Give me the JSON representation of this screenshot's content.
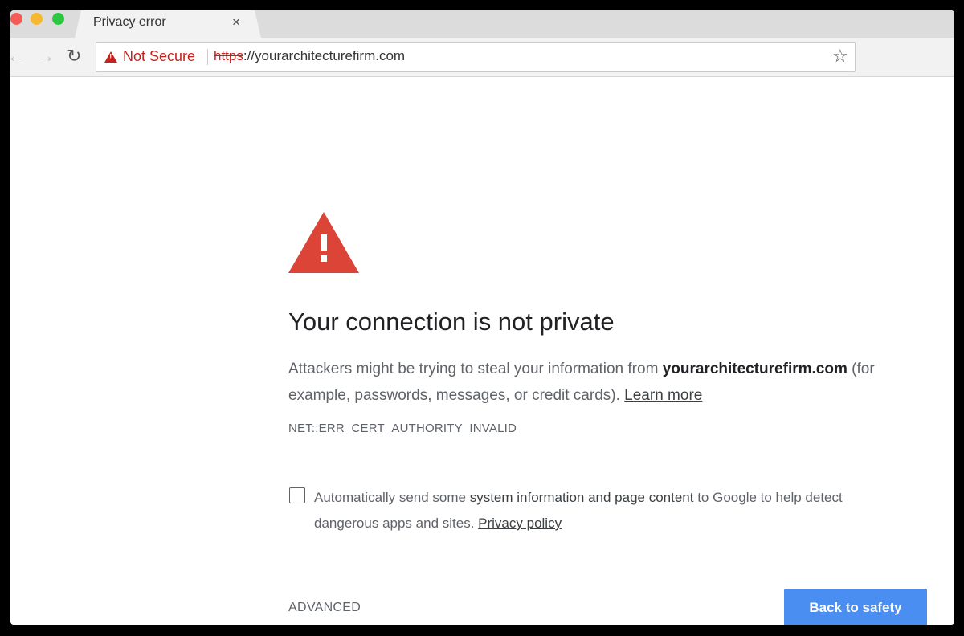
{
  "tab": {
    "title": "Privacy error",
    "close": "×"
  },
  "toolbar": {
    "back": "←",
    "forward": "→",
    "reload": "↻",
    "security_label": "Not Secure",
    "url_scheme": "https",
    "url_rest": "://yourarchitecturefirm.com",
    "bookmark": "☆"
  },
  "interstitial": {
    "heading": "Your connection is not private",
    "desc_prefix": "Attackers might be trying to steal your information from ",
    "domain": "yourarchitecturefirm.com",
    "desc_suffix": " (for example, passwords, messages, or credit cards). ",
    "learn_more": "Learn more",
    "error_code": "NET::ERR_CERT_AUTHORITY_INVALID",
    "optin_prefix": "Automatically send some ",
    "optin_link": "system information and page content",
    "optin_middle": " to Google to help detect dangerous apps and sites. ",
    "privacy_policy": "Privacy policy",
    "advanced": "ADVANCED",
    "back_to_safety": "Back to safety"
  },
  "colors": {
    "warning_red": "#db4437",
    "not_secure_red": "#c5221f",
    "button_blue": "#4b8ef1"
  }
}
